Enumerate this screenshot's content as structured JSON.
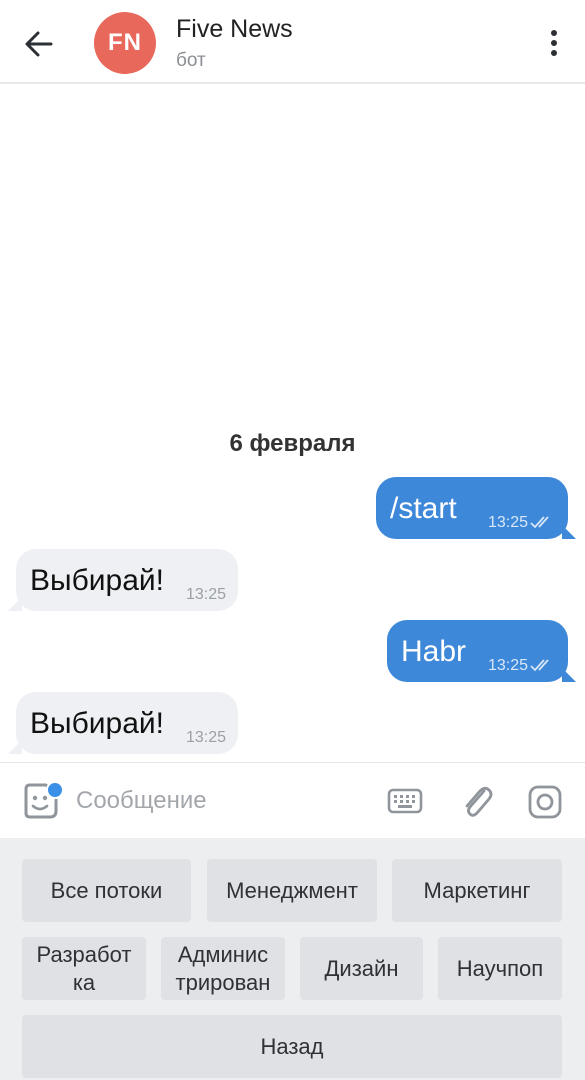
{
  "header": {
    "avatar_initials": "FN",
    "avatar_color": "#e8685b",
    "title": "Five News",
    "subtitle": "бот",
    "back_icon": "arrow-left-icon",
    "menu_icon": "more-vertical-icon"
  },
  "messages": {
    "date": "6 февраля",
    "items": [
      {
        "direction": "out",
        "text": "/start",
        "time": "13:25",
        "status": "read"
      },
      {
        "direction": "in",
        "text": "Выбирай!",
        "time": "13:25"
      },
      {
        "direction": "out",
        "text": "Habr",
        "time": "13:25",
        "status": "read"
      },
      {
        "direction": "in",
        "text": "Выбирай!",
        "time": "13:25"
      }
    ]
  },
  "input": {
    "placeholder": "Сообщение",
    "value": "",
    "icons": [
      "sticker-icon",
      "keyboard-icon",
      "paperclip-icon",
      "camera-icon"
    ]
  },
  "keyboard": {
    "rows": [
      [
        "Все потоки",
        "Менеджмент",
        "Маркетинг"
      ],
      [
        "Разработ\nка",
        "Админис\nтрирован",
        "Дизайн",
        "Научпоп"
      ],
      [
        "Назад"
      ]
    ]
  },
  "colors": {
    "outgoing_bubble": "#3d88d9",
    "incoming_bubble": "#eef0f3",
    "keyboard_bg": "#edeef0",
    "keyboard_button": "#dfe1e4"
  }
}
